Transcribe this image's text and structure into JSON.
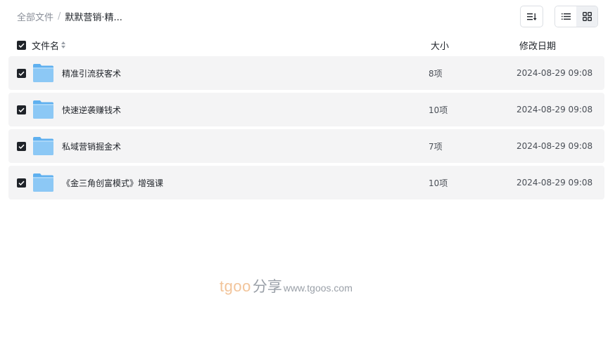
{
  "breadcrumb": {
    "root": "全部文件",
    "separator": "/",
    "current": "默默营销·精..."
  },
  "toolbar": {
    "sort_icon": "sort-icon",
    "list_view_icon": "list-view-icon",
    "grid_view_icon": "grid-view-icon",
    "active_view": "list"
  },
  "table": {
    "header": {
      "name": "文件名",
      "size": "大小",
      "date": "修改日期"
    },
    "rows": [
      {
        "name": "精准引流获客术",
        "size": "8项",
        "date": "2024-08-29 09:08",
        "checked": true
      },
      {
        "name": "快速逆袭赚钱术",
        "size": "10项",
        "date": "2024-08-29 09:08",
        "checked": true
      },
      {
        "name": "私域营销掘金术",
        "size": "7项",
        "date": "2024-08-29 09:08",
        "checked": true
      },
      {
        "name": "《金三角创富模式》增强课",
        "size": "10项",
        "date": "2024-08-29 09:08",
        "checked": true
      }
    ]
  },
  "watermark": {
    "brand": "tgoo",
    "cn": "分享",
    "url": "www.tgoos.com"
  },
  "colors": {
    "row_bg": "#f4f4f5",
    "checkbox": "#1f2329",
    "folder": "#8cc8f5"
  }
}
